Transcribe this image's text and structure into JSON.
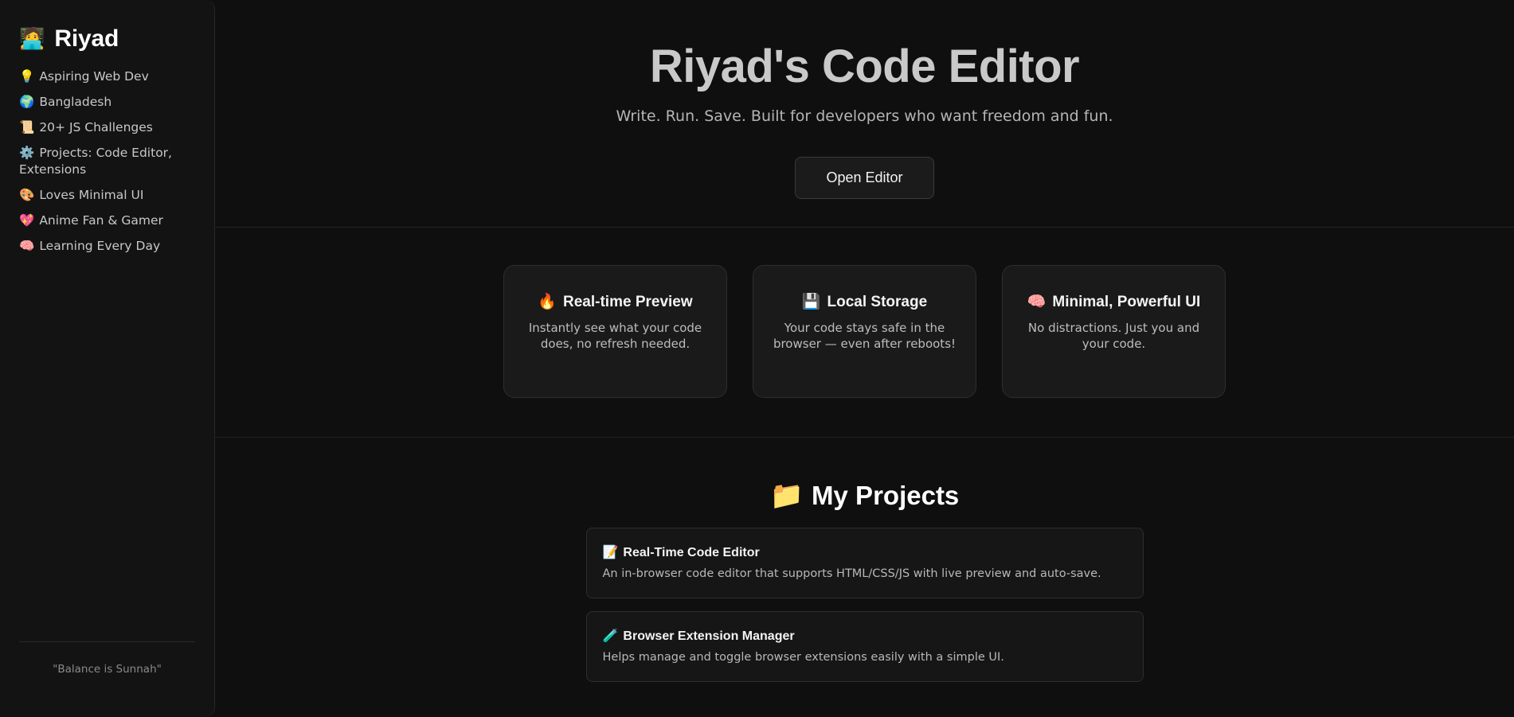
{
  "sidebar": {
    "brand_icon": "🧑‍💻",
    "brand_name": "Riyad",
    "items": [
      {
        "icon": "💡",
        "label": "Aspiring Web Dev"
      },
      {
        "icon": "🌍",
        "label": "Bangladesh"
      },
      {
        "icon": "📜",
        "label": "20+ JS Challenges"
      },
      {
        "icon": "⚙️",
        "label": "Projects: Code Editor, Extensions"
      },
      {
        "icon": "🎨",
        "label": "Loves Minimal UI"
      },
      {
        "icon": "💖",
        "label": "Anime Fan & Gamer"
      },
      {
        "icon": "🧠",
        "label": "Learning Every Day"
      }
    ],
    "footer_quote": "\"Balance is Sunnah\""
  },
  "hero": {
    "title": "Riyad's Code Editor",
    "subtitle": "Write. Run. Save. Built for developers who want freedom and fun.",
    "button_label": "Open Editor"
  },
  "features": [
    {
      "icon": "🔥",
      "title": "Real-time Preview",
      "desc": "Instantly see what your code does, no refresh needed."
    },
    {
      "icon": "💾",
      "title": "Local Storage",
      "desc": "Your code stays safe in the browser — even after reboots!"
    },
    {
      "icon": "🧠",
      "title": "Minimal, Powerful UI",
      "desc": "No distractions. Just you and your code."
    }
  ],
  "projects": {
    "heading_icon": "📁",
    "heading": "My Projects",
    "items": [
      {
        "icon": "📝",
        "title": "Real-Time Code Editor",
        "desc": "An in-browser code editor that supports HTML/CSS/JS with live preview and auto-save."
      },
      {
        "icon": "🧪",
        "title": "Browser Extension Manager",
        "desc": "Helps manage and toggle browser extensions easily with a simple UI."
      }
    ]
  }
}
